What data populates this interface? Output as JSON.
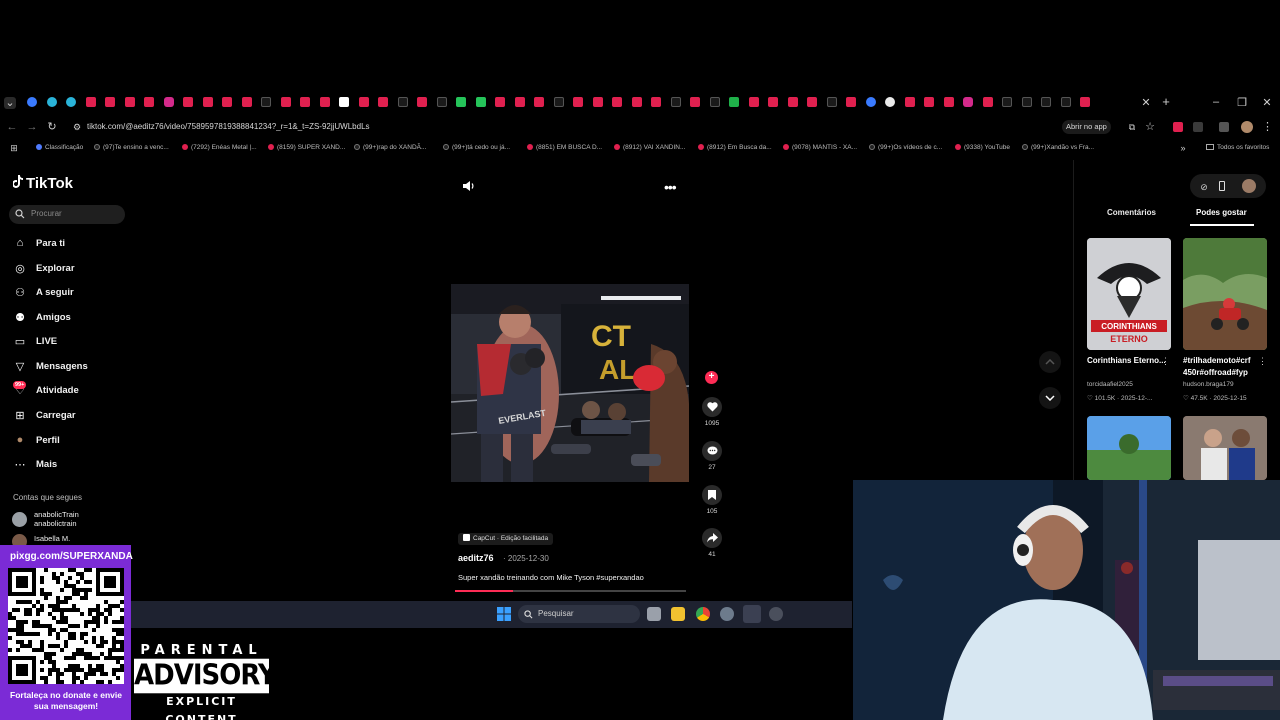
{
  "browser": {
    "url": "tiktok.com/@aeditz76/video/7589597819388841234?_r=1&_t=ZS-92jjUWLbdLs",
    "open_in_app": "Abrir no app",
    "all_bookmarks": "Todos os favoritos",
    "bookmarks": [
      {
        "label": "Classificação",
        "icon": "cl"
      },
      {
        "label": "(97)Te ensino a venc...",
        "icon": "tt"
      },
      {
        "label": "(7292) Enéas Metal |...",
        "icon": "yt"
      },
      {
        "label": "(8159) SUPER XAND...",
        "icon": "yt"
      },
      {
        "label": "(99+)rap do XANDÃ...",
        "icon": "tt"
      },
      {
        "label": "(99+)tá cedo ou já...",
        "icon": "tt"
      },
      {
        "label": "(8851) EM BUSCA D...",
        "icon": "yt"
      },
      {
        "label": "(8912) VAI XANDIN...",
        "icon": "yt"
      },
      {
        "label": "(8912) Em Busca da...",
        "icon": "yt"
      },
      {
        "label": "(9078) MANTIS - XA...",
        "icon": "yt"
      },
      {
        "label": "(99+)Os vídeos de c...",
        "icon": "tt"
      },
      {
        "label": "(9338) YouTube",
        "icon": "yt"
      },
      {
        "label": "(99+)Xandão vs Fra...",
        "icon": "tt"
      }
    ]
  },
  "tiktok": {
    "logo": "TikTok",
    "search_placeholder": "Procurar",
    "nav": [
      {
        "label": "Para ti",
        "icon": "home-icon"
      },
      {
        "label": "Explorar",
        "icon": "compass-icon"
      },
      {
        "label": "A seguir",
        "icon": "following-icon"
      },
      {
        "label": "Amigos",
        "icon": "friends-icon"
      },
      {
        "label": "LIVE",
        "icon": "live-icon"
      },
      {
        "label": "Mensagens",
        "icon": "messages-icon"
      },
      {
        "label": "Atividade",
        "icon": "activity-icon"
      },
      {
        "label": "Carregar",
        "icon": "upload-icon"
      },
      {
        "label": "Perfil",
        "icon": "profile-icon"
      },
      {
        "label": "Mais",
        "icon": "more-icon"
      }
    ],
    "activity_badge": "99+",
    "following_title": "Contas que segues",
    "following": [
      {
        "name": "anabolicTrain",
        "handle": "anabolictrain"
      },
      {
        "name": "Isabella M.",
        "handle": ""
      }
    ],
    "video": {
      "capcut": "CapCut · Edição facilitada",
      "author": "aeditz76",
      "date": "2025-12-30",
      "caption": "Super xandão treinando com Mike Tyson #superxandao",
      "progress": 0.25,
      "likes": "1095",
      "comments": "27",
      "saves": "105",
      "shares": "41"
    },
    "right_tabs": [
      "Comentários",
      "Podes gostar"
    ],
    "recommended": [
      {
        "title": "Corinthians Eterno...",
        "user": "torcidaafiel2025",
        "views": "101.5K",
        "date": "2025-12-..."
      },
      {
        "title": "#trilhademoto#crf 450r#offroad#fyp",
        "user": "hudson.braga179",
        "views": "47.5K",
        "date": "2025-12-15"
      }
    ]
  },
  "taskbar": {
    "search_placeholder": "Pesquisar"
  },
  "overlay": {
    "qr_url": "pixgg.com/SUPERXANDA",
    "qr_text": "Fortaleça no donate e envie sua mensagem!",
    "advisory_top": "PARENTAL",
    "advisory_mid": "ADVISORY",
    "advisory_bottom": "EXPLICIT CONTENT"
  },
  "colors": {
    "accent": "#fe2c55",
    "qr_bg": "#7b2bd6"
  }
}
